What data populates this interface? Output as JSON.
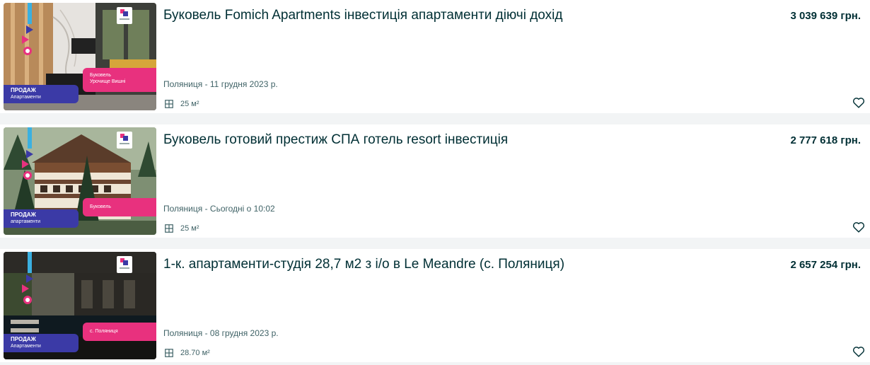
{
  "listings": [
    {
      "title": "Буковель Fomich Apartments інвестиція апартаменти діючі дохід",
      "price": "3 039 639 грн.",
      "location": "Поляниця - 11 грудня 2023 р.",
      "area": "25 м²",
      "photo_labels": {
        "sale": "ПРОДАЖ",
        "type": "Апартаменти",
        "place": "Буковель\nУрочище Вишні"
      }
    },
    {
      "title": "Буковель готовий престиж СПА готель resort інвестиція",
      "price": "2 777 618 грн.",
      "location": "Поляниця - Сьогодні о 10:02",
      "area": "25 м²",
      "photo_labels": {
        "sale": "ПРОДАЖ",
        "type": "апартаменти",
        "place": "Буковель"
      }
    },
    {
      "title": "1-к. апартаменти-студія 28,7 м2 з і/о в Le Meandre (с. Поляниця)",
      "price": "2 657 254 грн.",
      "location": "Поляниця - 08 грудня 2023 р.",
      "area": "28.70 м²",
      "photo_labels": {
        "sale": "ПРОДАЖ",
        "type": "Апартаменти",
        "place": "с. Поляниця"
      }
    }
  ],
  "icons": {
    "area": "floor-plan-icon",
    "favorite": "heart-outline-icon"
  },
  "colors": {
    "text": "#002f34",
    "muted": "#406367",
    "brand_pink": "#e8317e",
    "brand_blue": "#3b3aa6",
    "background": "#f2f4f5"
  }
}
